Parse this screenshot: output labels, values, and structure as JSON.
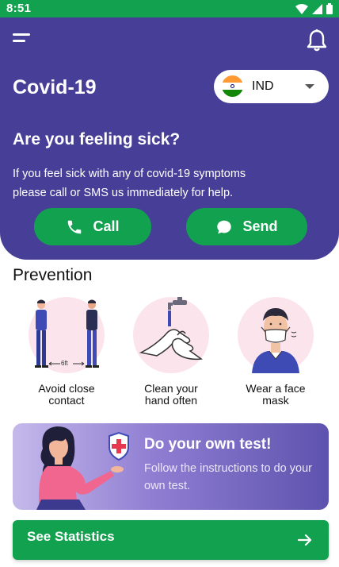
{
  "status_bar": {
    "time": "8:51"
  },
  "header": {
    "title": "Covid-19",
    "country": {
      "code": "IND",
      "flag_colors": [
        "#ff9933",
        "#ffffff",
        "#138808"
      ]
    }
  },
  "sick_section": {
    "heading": "Are you feeling sick?",
    "description": "If you feel sick with any of covid-19 symptoms please call or SMS us immediately for help.",
    "call_label": "Call",
    "send_label": "Send"
  },
  "prevention": {
    "title": "Prevention",
    "items": [
      {
        "label": "Avoid close contact",
        "icon": "distance-illustration",
        "caption": "6ft"
      },
      {
        "label": "Clean your hand often",
        "icon": "handwash-illustration"
      },
      {
        "label": "Wear a face mask",
        "icon": "mask-illustration"
      }
    ]
  },
  "test_card": {
    "title": "Do your own test!",
    "description": "Follow the instructions to do your own test."
  },
  "stats_button": {
    "label": "See Statistics"
  },
  "colors": {
    "primary": "#473f97",
    "accent_green": "#12a14f",
    "pink_bg": "#fbe4ec"
  }
}
